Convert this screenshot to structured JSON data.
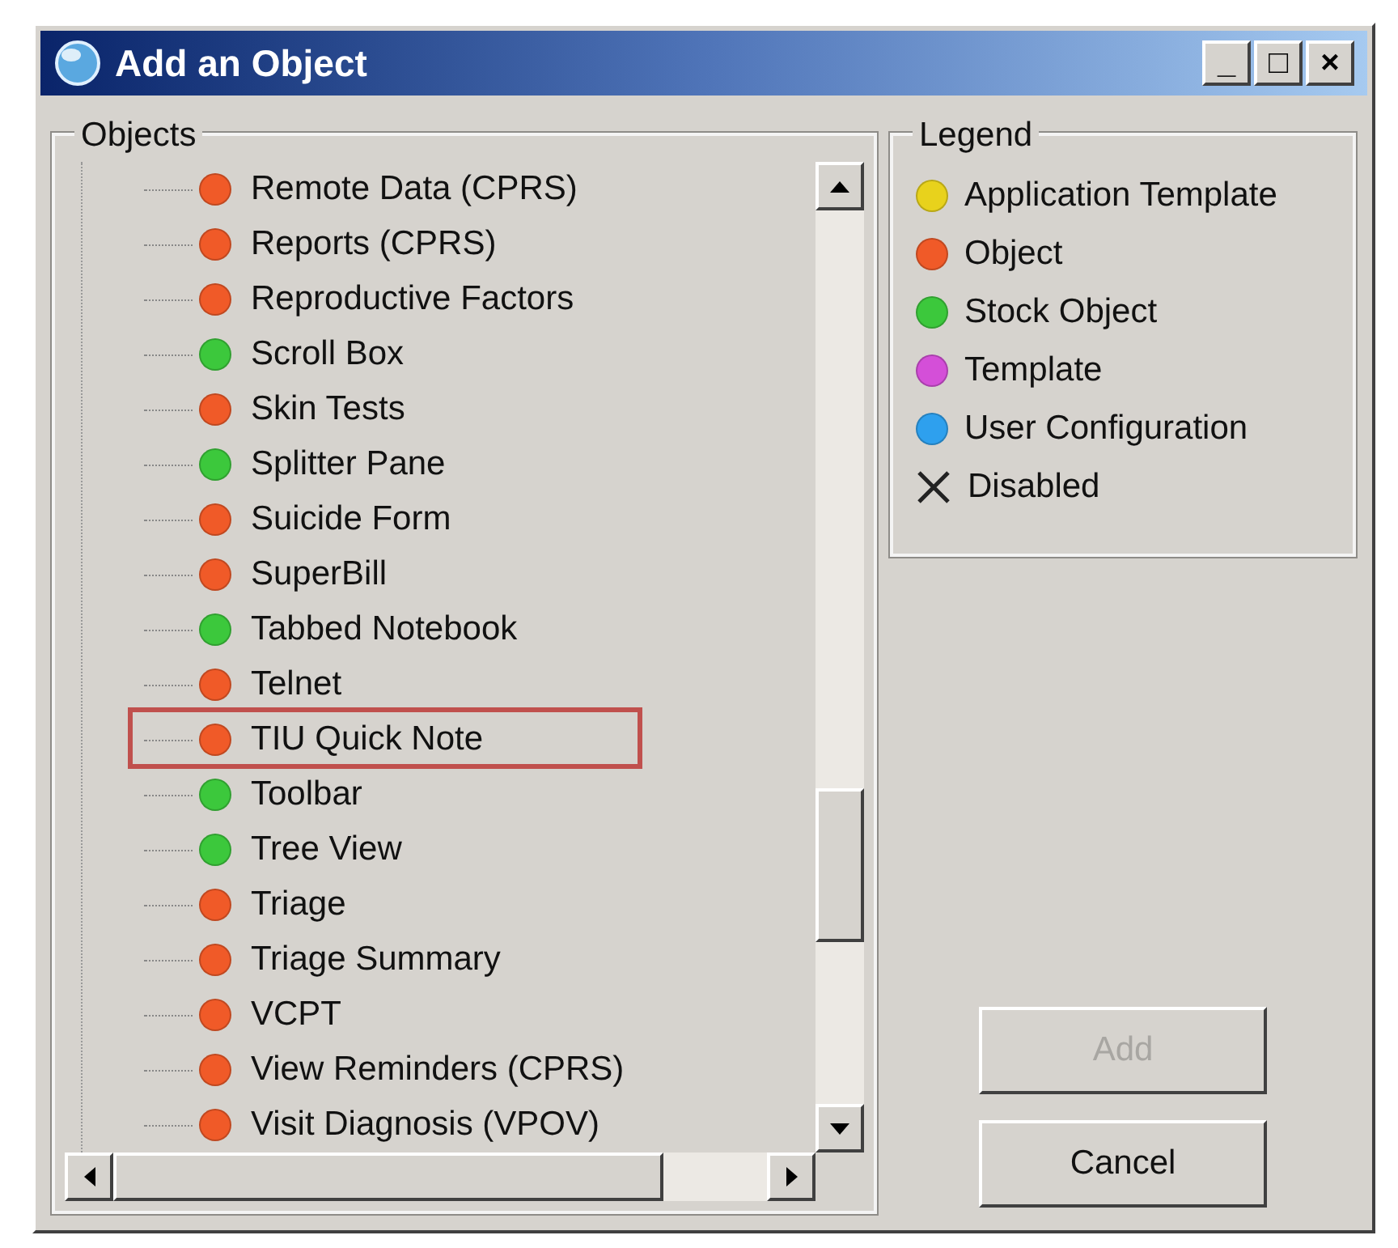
{
  "window": {
    "title": "Add an Object",
    "controls": [
      "_",
      "□",
      "×"
    ]
  },
  "objects": {
    "title": "Objects",
    "items": [
      {
        "label": "Remote Data (CPRS)",
        "color": "#f05a28",
        "highlighted": false
      },
      {
        "label": "Reports (CPRS)",
        "color": "#f05a28",
        "highlighted": false
      },
      {
        "label": "Reproductive Factors",
        "color": "#f05a28",
        "highlighted": false
      },
      {
        "label": "Scroll Box",
        "color": "#3cc83c",
        "highlighted": false
      },
      {
        "label": "Skin Tests",
        "color": "#f05a28",
        "highlighted": false
      },
      {
        "label": "Splitter Pane",
        "color": "#3cc83c",
        "highlighted": false
      },
      {
        "label": "Suicide Form",
        "color": "#f05a28",
        "highlighted": false
      },
      {
        "label": "SuperBill",
        "color": "#f05a28",
        "highlighted": false
      },
      {
        "label": "Tabbed Notebook",
        "color": "#3cc83c",
        "highlighted": false
      },
      {
        "label": "Telnet",
        "color": "#f05a28",
        "highlighted": false
      },
      {
        "label": "TIU Quick Note",
        "color": "#f05a28",
        "highlighted": true
      },
      {
        "label": "Toolbar",
        "color": "#3cc83c",
        "highlighted": false
      },
      {
        "label": "Tree View",
        "color": "#3cc83c",
        "highlighted": false
      },
      {
        "label": "Triage",
        "color": "#f05a28",
        "highlighted": false
      },
      {
        "label": "Triage Summary",
        "color": "#f05a28",
        "highlighted": false
      },
      {
        "label": "VCPT",
        "color": "#f05a28",
        "highlighted": false
      },
      {
        "label": "View Reminders (CPRS)",
        "color": "#f05a28",
        "highlighted": false
      },
      {
        "label": "Visit Diagnosis (VPOV)",
        "color": "#f05a28",
        "highlighted": false
      }
    ]
  },
  "legend": {
    "title": "Legend",
    "items": [
      {
        "kind": "dot",
        "label": "Application Template",
        "color": "#e8d21c"
      },
      {
        "kind": "dot",
        "label": "Object",
        "color": "#f05a28"
      },
      {
        "kind": "dot",
        "label": "Stock Object",
        "color": "#3cc83c"
      },
      {
        "kind": "dot",
        "label": "Template",
        "color": "#d44fd8"
      },
      {
        "kind": "dot",
        "label": "User Configuration",
        "color": "#2ea0ee"
      },
      {
        "kind": "cross",
        "label": "Disabled"
      }
    ]
  },
  "buttons": [
    {
      "label": "Add",
      "disabled": true
    },
    {
      "label": "Cancel",
      "disabled": false
    }
  ]
}
